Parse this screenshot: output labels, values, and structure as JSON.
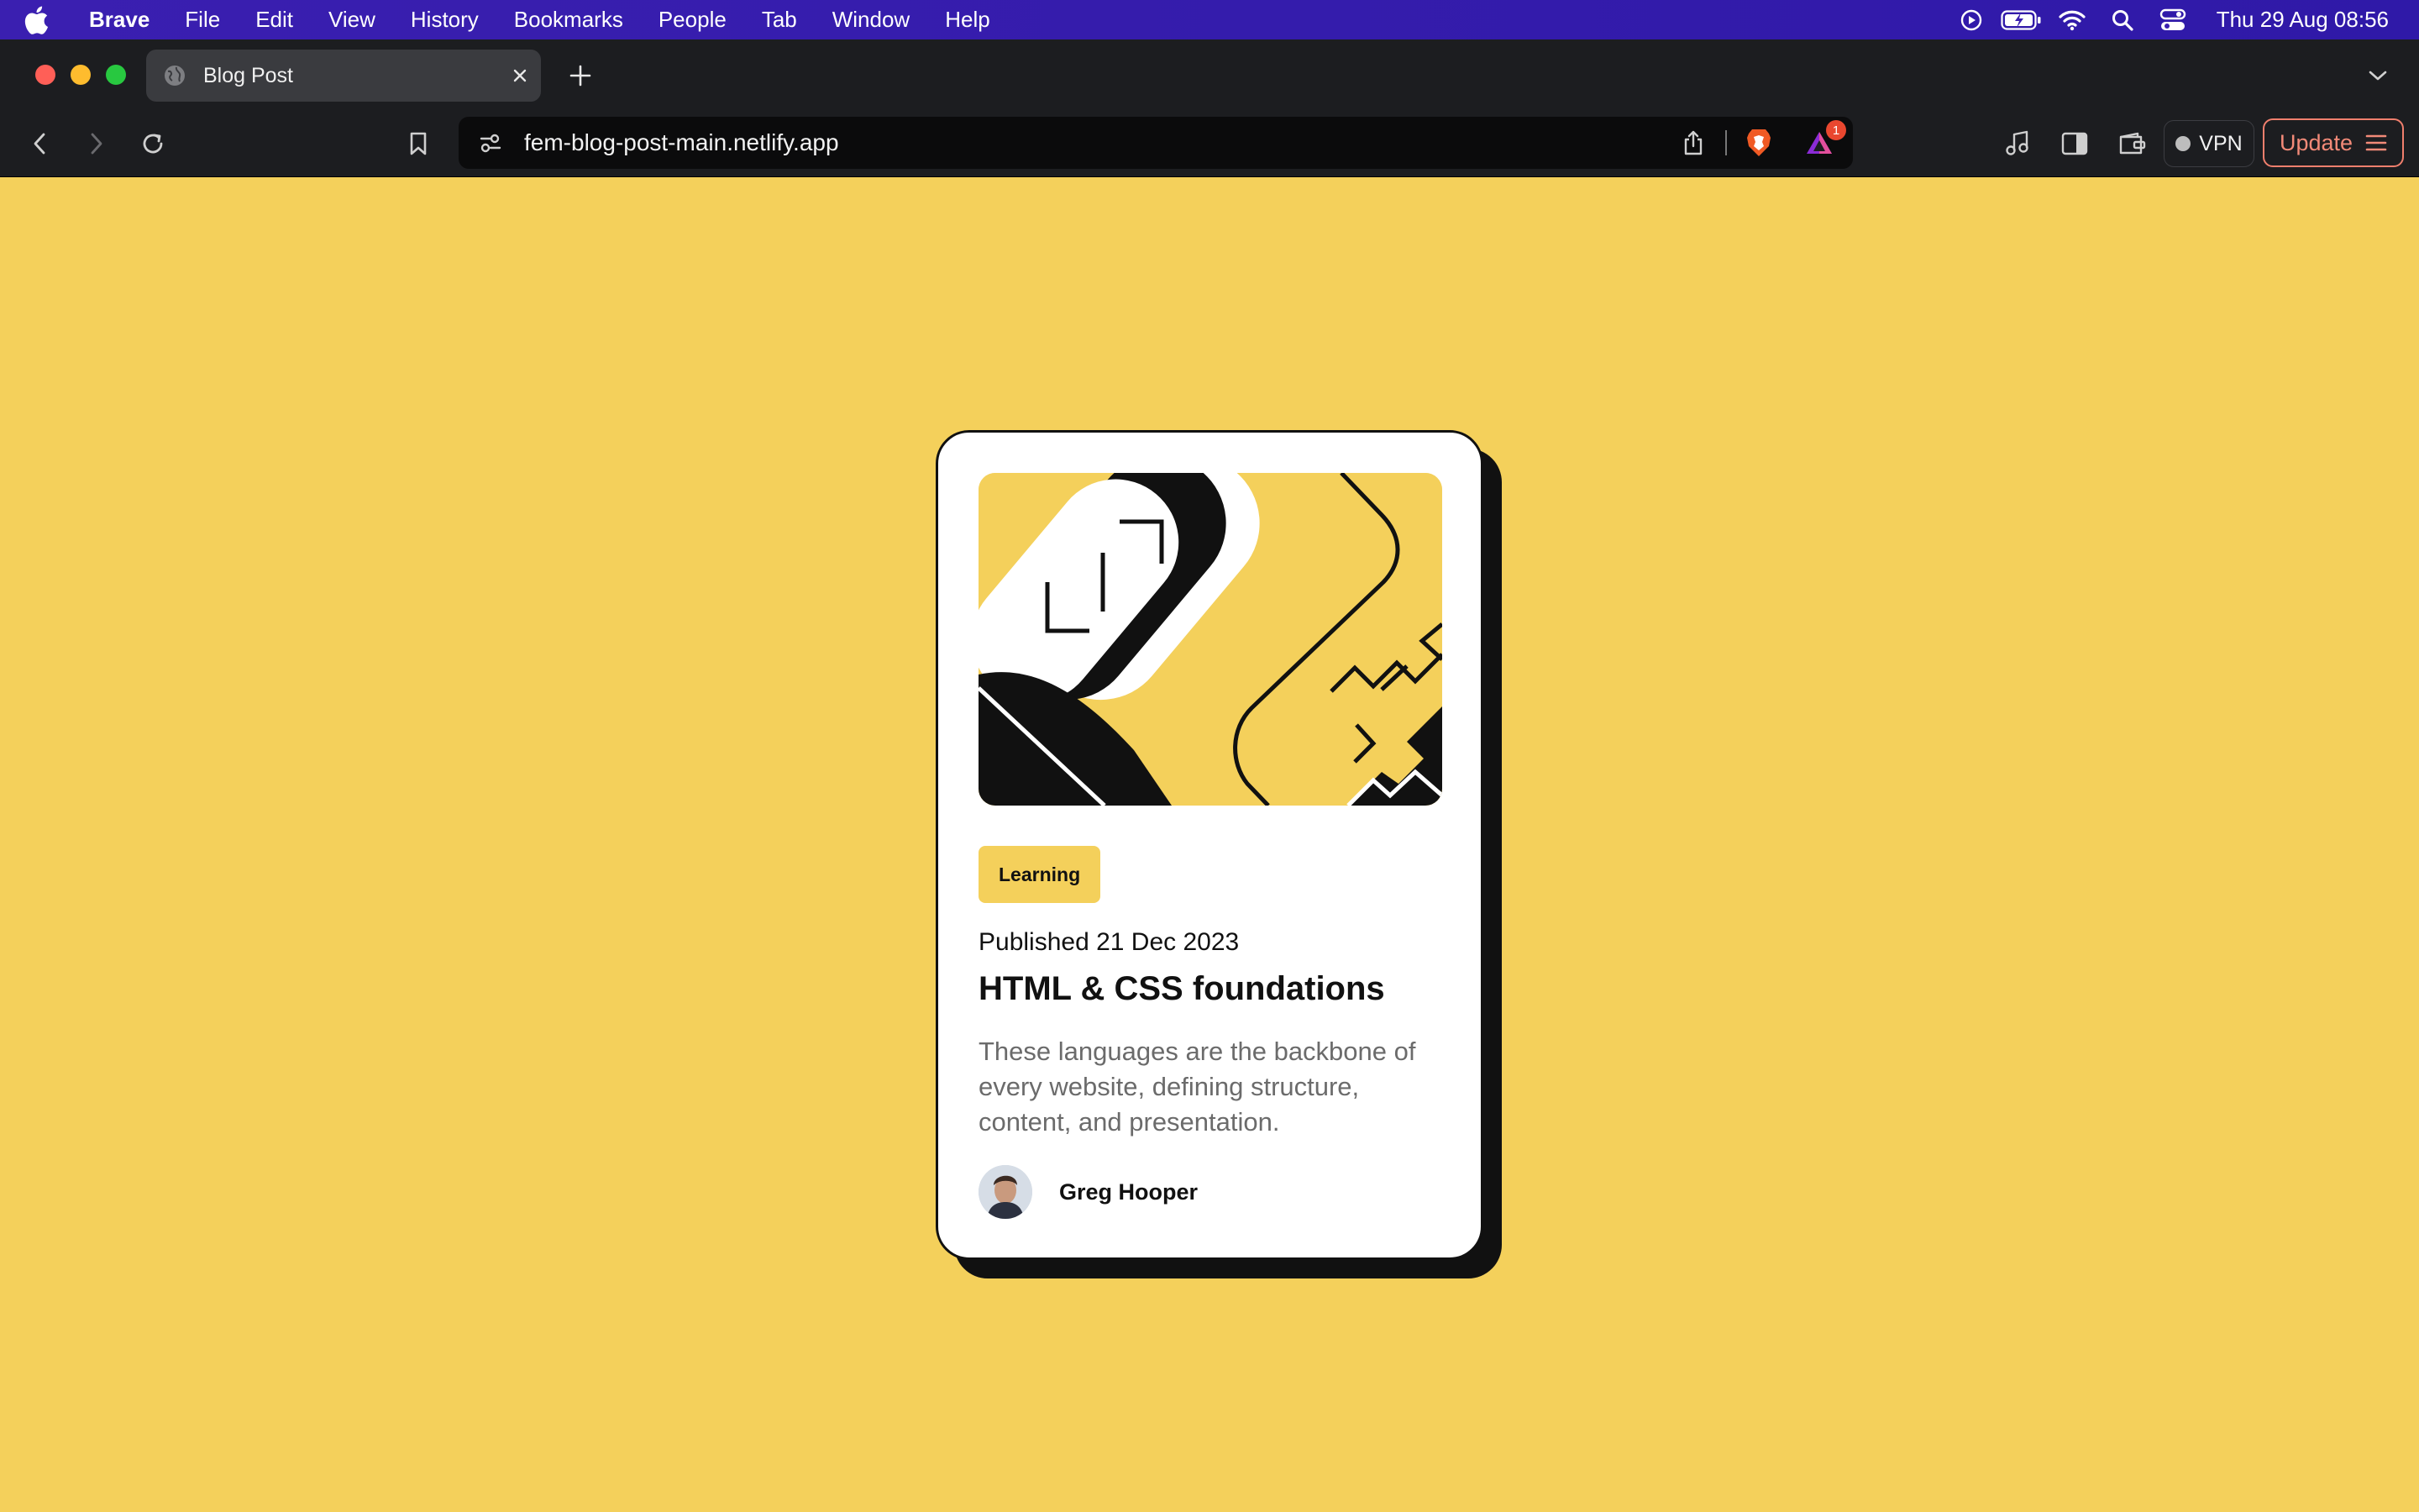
{
  "menubar": {
    "app_name": "Brave",
    "items": [
      "File",
      "Edit",
      "View",
      "History",
      "Bookmarks",
      "People",
      "Tab",
      "Window",
      "Help"
    ],
    "clock": "Thu 29 Aug  08:56",
    "status_icons": [
      "play-circle-icon",
      "battery-charging-icon",
      "wifi-icon",
      "spotlight-search-icon",
      "control-center-icon"
    ]
  },
  "tabs": {
    "active_title": "Blog Post"
  },
  "toolbar": {
    "url": "fem-blog-post-main.netlify.app",
    "rewards_badge": "1",
    "vpn_label": "VPN",
    "update_label": "Update"
  },
  "colors": {
    "page_background": "#f4d05b",
    "menubar": "#3a1fb0",
    "browser_chrome": "#1c1d20",
    "tag_background": "#f4d05b",
    "update_accent": "#f07f6d"
  },
  "card": {
    "tag": "Learning",
    "published": "Published 21 Dec 2023",
    "title": "HTML & CSS foundations",
    "description": "These languages are the backbone of every website, defining structure, content, and presentation.",
    "author": "Greg Hooper"
  }
}
